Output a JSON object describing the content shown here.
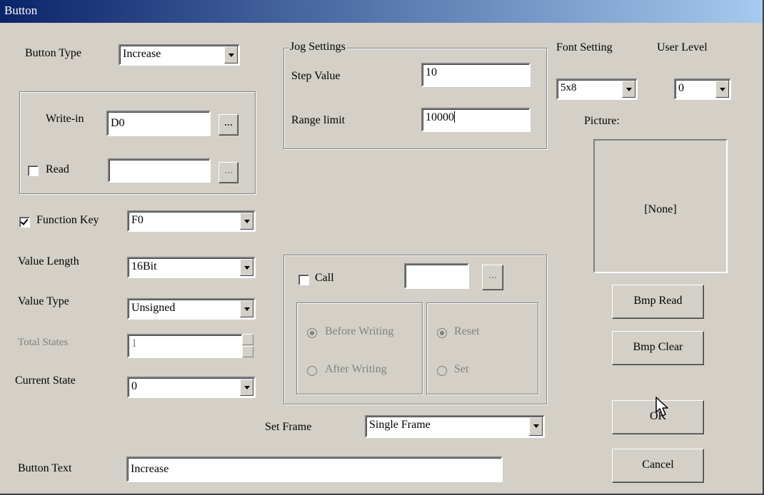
{
  "window": {
    "title": "Button"
  },
  "button_type": {
    "label": "Button Type",
    "value": "Increase"
  },
  "address": {
    "write_in_label": "Write-in",
    "write_in_value": "D0",
    "read_label": "Read",
    "read_checked": false,
    "read_value": "",
    "browse_label": "..."
  },
  "function_key": {
    "label": "Function Key",
    "checked": true,
    "value": "F0"
  },
  "value_length": {
    "label": "Value Length",
    "value": "16Bit"
  },
  "value_type": {
    "label": "Value Type",
    "value": "Unsigned"
  },
  "total_states": {
    "label": "Total States",
    "value": "1"
  },
  "current_state": {
    "label": "Current State",
    "value": "0"
  },
  "jog": {
    "title": "Jog Settings",
    "step_label": "Step Value",
    "step_value": "10",
    "range_label": "Range limit",
    "range_value": "10000"
  },
  "call": {
    "label": "Call",
    "checked": false,
    "value": "",
    "browse_label": "...",
    "before_writing": "Before Writing",
    "after_writing": "After Writing",
    "reset": "Reset",
    "set": "Set"
  },
  "set_frame": {
    "label": "Set Frame",
    "value": "Single Frame"
  },
  "button_text": {
    "label": "Button Text",
    "value": "Increase"
  },
  "font_setting": {
    "label": "Font Setting",
    "value": "5x8"
  },
  "user_level": {
    "label": "User Level",
    "value": "0"
  },
  "picture": {
    "label": "Picture:",
    "value": "[None]"
  },
  "buttons": {
    "bmp_read": "Bmp Read",
    "bmp_clear": "Bmp Clear",
    "ok": "OK",
    "cancel": "Cancel"
  }
}
